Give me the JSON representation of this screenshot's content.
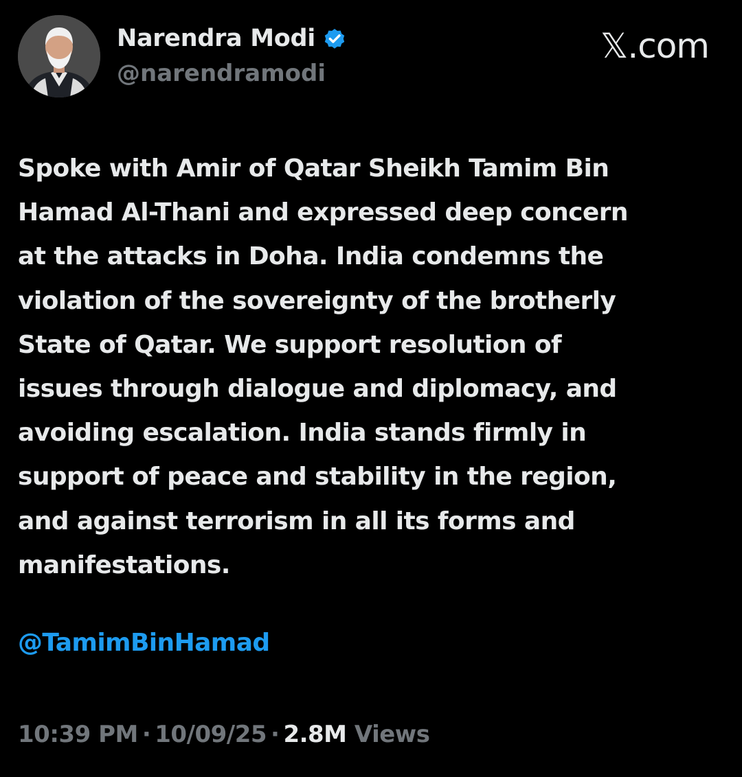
{
  "author": {
    "display_name": "Narendra Modi",
    "handle": "@narendramodi",
    "verified": true,
    "avatar_icon": "profile-photo"
  },
  "brand": "𝕏.com",
  "tweet": {
    "text": "Spoke with Amir of Qatar Sheikh Tamim Bin\nHamad Al-Thani and expressed deep concern\nat the attacks in Doha. India condemns the\nviolation of the sovereignty of the brotherly\nState of Qatar. We support resolution of\nissues through dialogue and diplomacy, and\navoiding escalation. India stands firmly in\nsupport of peace and stability in the region,\nand against terrorism in all its forms and\nmanifestations.",
    "mention": "@TamimBinHamad"
  },
  "meta": {
    "time": "10:39 PM",
    "separator": "·",
    "date": "10/09/25",
    "views_count": "2.8M",
    "views_label": "Views"
  },
  "colors": {
    "background": "#000000",
    "text_primary": "#e7e9ea",
    "text_secondary": "#71767b",
    "link": "#1d9bf0",
    "verified_badge": "#1d9bf0"
  }
}
